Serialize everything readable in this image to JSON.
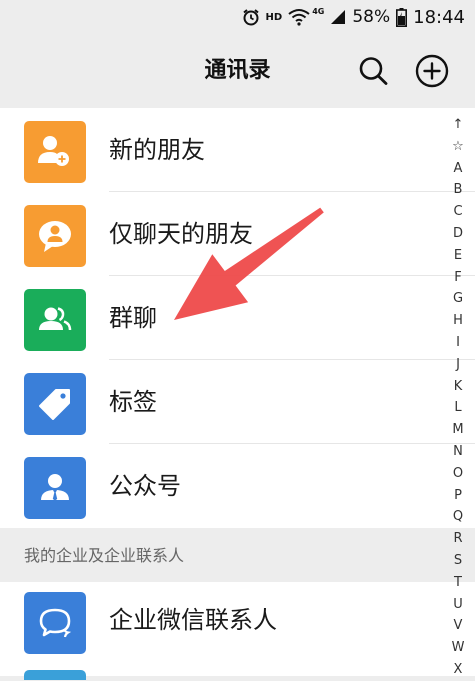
{
  "status_bar": {
    "hd": "HD",
    "network": "4G",
    "battery_percent": "58%",
    "time": "18:44"
  },
  "header": {
    "title": "通讯录",
    "search_icon": "search-icon",
    "add_icon": "plus-circle-icon"
  },
  "menu": [
    {
      "label": "新的朋友",
      "icon": "add-friend-icon",
      "color": "#f79c32"
    },
    {
      "label": "仅聊天的朋友",
      "icon": "chat-friend-icon",
      "color": "#f79c32"
    },
    {
      "label": "群聊",
      "icon": "group-chat-icon",
      "color": "#1aad5a"
    },
    {
      "label": "标签",
      "icon": "tag-icon",
      "color": "#3a7fd9"
    },
    {
      "label": "公众号",
      "icon": "official-account-icon",
      "color": "#3a7fd9"
    }
  ],
  "section": {
    "title": "我的企业及企业联系人"
  },
  "enterprise": [
    {
      "label": "企业微信联系人",
      "icon": "enterprise-contact-icon",
      "color": "#3a7fd9"
    }
  ],
  "index": [
    "↑",
    "☆",
    "A",
    "B",
    "C",
    "D",
    "E",
    "F",
    "G",
    "H",
    "I",
    "J",
    "K",
    "L",
    "M",
    "N",
    "O",
    "P",
    "Q",
    "R",
    "S",
    "T",
    "U",
    "V",
    "W",
    "X"
  ],
  "annotation": {
    "arrow_color": "#ee4a4a"
  }
}
